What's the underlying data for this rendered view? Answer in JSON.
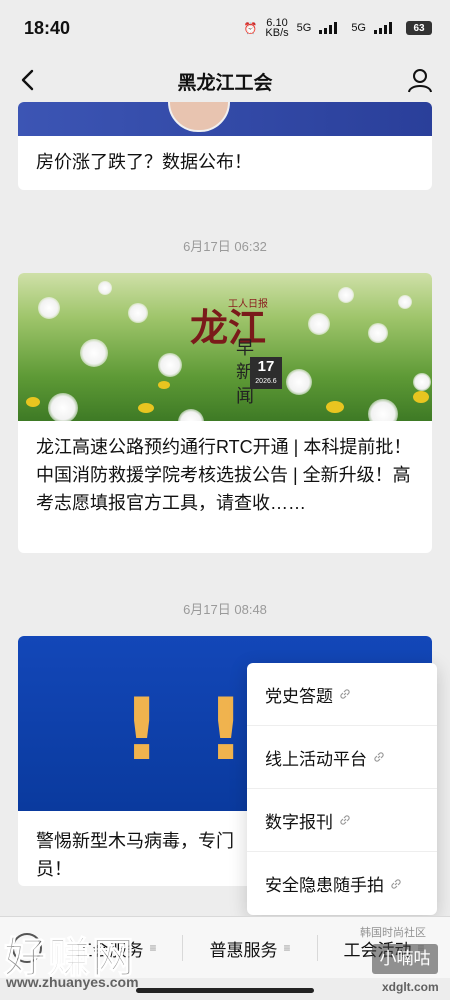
{
  "status": {
    "time": "18:40",
    "speed_top": "6.10",
    "speed_unit": "KB/s",
    "net1": "5G",
    "net2": "5G",
    "battery": "63"
  },
  "nav": {
    "title": "黑龙江工会"
  },
  "feed": [
    {
      "title": "房价涨了跌了？数据公布！"
    },
    {
      "time": "6月17日 06:32",
      "title": "龙江高速公路预约通行RTC开通 | 本科提前批！中国消防救援学院考核选拔公告 | 全新升级！高考志愿填报官方工具，请查收……",
      "image": {
        "logo": "工人日报",
        "brand_big": "龙江",
        "brand_sub": "早新闻",
        "date_day": "17",
        "date_sub": "2026.6"
      }
    },
    {
      "time": "6月17日 08:48",
      "title_line1": "警惕新型木马病毒，专门",
      "title_line2": "员！"
    }
  ],
  "popup": {
    "items": [
      "党史答题",
      "线上活动平台",
      "数字报刊",
      "安全隐患随手拍"
    ]
  },
  "bottom_menu": {
    "tabs": [
      "工会服务",
      "普惠服务",
      "工会活动"
    ]
  },
  "watermarks": {
    "left_big": "好赚网",
    "left_url": "www.zhuanyes.com",
    "right_box": "小喃咕",
    "right_small": "韩国时尚社区",
    "right_url": "xdglt.com"
  }
}
